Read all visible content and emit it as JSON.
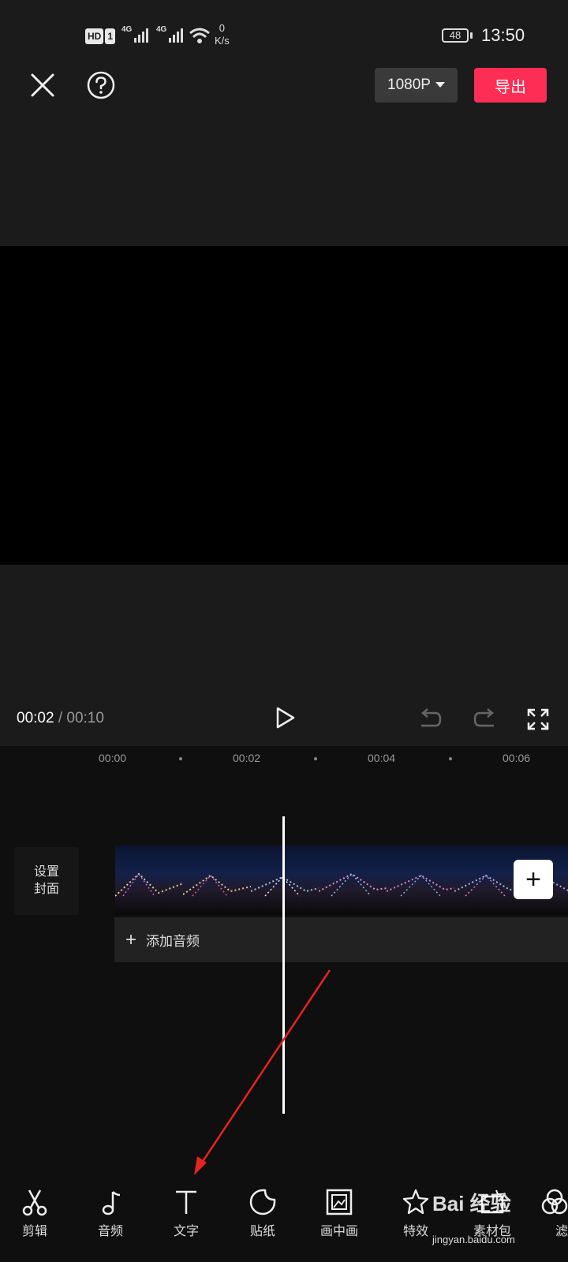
{
  "status_bar": {
    "hd": "HD",
    "sim": "1",
    "network_1": "4G",
    "network_2": "4G",
    "speed_value": "0",
    "speed_unit": "K/s",
    "battery": "48",
    "time": "13:50"
  },
  "top_bar": {
    "resolution": "1080P",
    "export_label": "导出"
  },
  "playback": {
    "current_time": "00:02",
    "separator": " / ",
    "total_time": "00:10"
  },
  "timeline": {
    "ticks": [
      "00:00",
      "00:02",
      "00:04",
      "00:06"
    ],
    "cover_line1": "设置",
    "cover_line2": "封面",
    "add_audio_label": "添加音频",
    "add_clip_symbol": "+"
  },
  "toolbar": {
    "items": [
      {
        "label": "剪辑",
        "icon": "scissors-icon"
      },
      {
        "label": "音频",
        "icon": "music-note-icon"
      },
      {
        "label": "文字",
        "icon": "text-icon"
      },
      {
        "label": "贴纸",
        "icon": "sticker-icon"
      },
      {
        "label": "画中画",
        "icon": "picture-in-picture-icon"
      },
      {
        "label": "特效",
        "icon": "effects-star-icon"
      },
      {
        "label": "素材包",
        "icon": "material-pack-icon"
      },
      {
        "label": "滤",
        "icon": "filter-icon"
      }
    ]
  },
  "watermark": {
    "brand": "Bai 经验",
    "url": "jingyan.baidu.com"
  },
  "colors": {
    "accent": "#fd2d55",
    "annotation_arrow": "#e8231f"
  }
}
